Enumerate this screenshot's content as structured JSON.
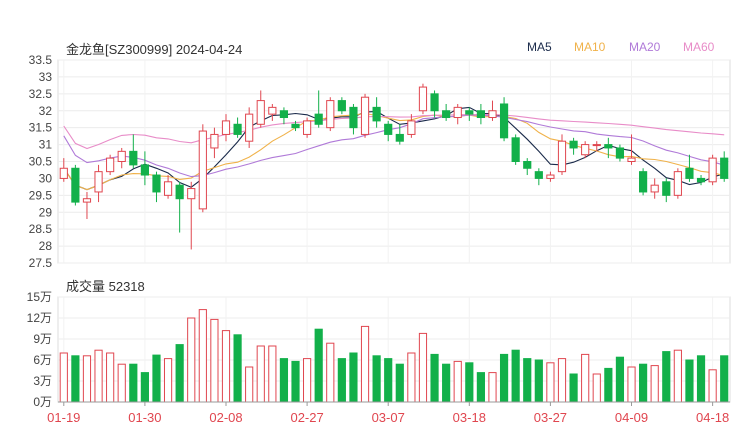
{
  "title": "金龙鱼[SZ300999] 2024-04-24",
  "volume_label": "成交量 52318",
  "legend": [
    {
      "name": "MA5",
      "color": "#1a2a4a"
    },
    {
      "name": "MA10",
      "color": "#f0b24a"
    },
    {
      "name": "MA20",
      "color": "#b07ad8"
    },
    {
      "name": "MA60",
      "color": "#e88cc8"
    }
  ],
  "colors": {
    "up": "#e0464f",
    "down": "#12b04a"
  },
  "chart_data": [
    {
      "type": "candlestick",
      "ylim": [
        27.5,
        33.5
      ],
      "yticks": [
        "33.5",
        "33",
        "32.5",
        "32",
        "31.5",
        "31",
        "30.5",
        "30",
        "29.5",
        "29",
        "28.5",
        "28",
        "27.5"
      ],
      "x_tick_labels": [
        {
          "label": "01-19",
          "index": 0
        },
        {
          "label": "01-30",
          "index": 7
        },
        {
          "label": "02-08",
          "index": 14
        },
        {
          "label": "02-27",
          "index": 21
        },
        {
          "label": "03-07",
          "index": 28
        },
        {
          "label": "03-18",
          "index": 35
        },
        {
          "label": "03-27",
          "index": 42
        },
        {
          "label": "04-09",
          "index": 49
        },
        {
          "label": "04-18",
          "index": 56
        }
      ],
      "candles": [
        [
          30.0,
          30.3,
          30.6,
          29.9
        ],
        [
          30.3,
          29.3,
          30.4,
          29.2
        ],
        [
          29.3,
          29.4,
          29.6,
          28.8
        ],
        [
          29.6,
          30.2,
          30.4,
          29.3
        ],
        [
          30.2,
          30.6,
          30.7,
          30.1
        ],
        [
          30.5,
          30.8,
          30.9,
          30.3
        ],
        [
          30.8,
          30.4,
          31.3,
          30.3
        ],
        [
          30.4,
          30.1,
          30.8,
          29.8
        ],
        [
          30.1,
          29.6,
          30.2,
          29.3
        ],
        [
          29.5,
          29.9,
          30.1,
          29.4
        ],
        [
          29.8,
          29.4,
          29.9,
          28.4
        ],
        [
          29.4,
          29.7,
          29.9,
          27.9
        ],
        [
          29.1,
          31.4,
          31.6,
          29.0
        ],
        [
          30.9,
          31.3,
          31.5,
          30.6
        ],
        [
          31.3,
          31.7,
          31.9,
          31.1
        ],
        [
          31.6,
          31.3,
          31.8,
          31.2
        ],
        [
          31.1,
          31.9,
          32.1,
          30.9
        ],
        [
          31.6,
          32.3,
          32.6,
          31.5
        ],
        [
          31.9,
          32.1,
          32.2,
          31.7
        ],
        [
          32.0,
          31.8,
          32.1,
          31.6
        ],
        [
          31.6,
          31.5,
          31.7,
          31.4
        ],
        [
          31.3,
          31.7,
          31.8,
          31.2
        ],
        [
          31.9,
          31.6,
          32.6,
          31.5
        ],
        [
          31.5,
          32.3,
          32.4,
          31.4
        ],
        [
          32.3,
          32.0,
          32.4,
          31.9
        ],
        [
          32.1,
          31.5,
          32.2,
          31.3
        ],
        [
          31.3,
          32.4,
          32.5,
          31.2
        ],
        [
          32.1,
          31.7,
          32.4,
          31.5
        ],
        [
          31.6,
          31.3,
          31.7,
          31.1
        ],
        [
          31.3,
          31.1,
          31.6,
          31.0
        ],
        [
          31.3,
          31.7,
          31.9,
          31.2
        ],
        [
          32.0,
          32.7,
          32.8,
          31.9
        ],
        [
          32.5,
          32.0,
          32.6,
          31.8
        ],
        [
          32.0,
          31.8,
          32.2,
          31.7
        ],
        [
          31.8,
          32.1,
          32.2,
          31.6
        ],
        [
          32.0,
          31.9,
          32.1,
          31.7
        ],
        [
          32.0,
          31.8,
          32.2,
          31.6
        ],
        [
          31.8,
          32.0,
          32.3,
          31.7
        ],
        [
          32.2,
          31.2,
          32.4,
          31.1
        ],
        [
          31.2,
          30.5,
          31.3,
          30.4
        ],
        [
          30.5,
          30.3,
          30.6,
          30.1
        ],
        [
          30.2,
          30.0,
          30.3,
          29.8
        ],
        [
          30.0,
          30.1,
          30.2,
          29.9
        ],
        [
          30.2,
          31.1,
          31.3,
          30.1
        ],
        [
          31.1,
          30.9,
          31.2,
          30.7
        ],
        [
          30.7,
          31.0,
          31.1,
          30.6
        ],
        [
          31.0,
          31.0,
          31.1,
          30.8
        ],
        [
          31.0,
          30.9,
          31.2,
          30.6
        ],
        [
          30.9,
          30.6,
          31.0,
          30.5
        ],
        [
          30.5,
          30.6,
          31.3,
          30.4
        ],
        [
          30.2,
          29.6,
          30.3,
          29.5
        ],
        [
          29.6,
          29.8,
          30.0,
          29.4
        ],
        [
          29.9,
          29.5,
          30.0,
          29.3
        ],
        [
          29.5,
          30.2,
          30.3,
          29.4
        ],
        [
          30.3,
          30.0,
          30.7,
          29.9
        ],
        [
          30.0,
          29.9,
          30.1,
          29.8
        ],
        [
          29.9,
          30.6,
          30.7,
          29.8
        ],
        [
          30.6,
          30.0,
          30.8,
          29.9
        ]
      ]
    },
    {
      "type": "bar",
      "ylim": [
        0,
        150000
      ],
      "yticks": [
        "15万",
        "12万",
        "9万",
        "6万",
        "3万",
        "0万"
      ],
      "volumes": [
        70000,
        66000,
        66000,
        74000,
        70000,
        54000,
        54000,
        42000,
        67000,
        62000,
        82000,
        120000,
        132000,
        118000,
        102000,
        96000,
        50000,
        80000,
        80000,
        62000,
        58000,
        62000,
        104000,
        84000,
        62000,
        70000,
        108000,
        66000,
        62000,
        54000,
        70000,
        98000,
        68000,
        54000,
        58000,
        56000,
        42000,
        42000,
        68000,
        74000,
        62000,
        60000,
        56000,
        62000,
        40000,
        68000,
        40000,
        48000,
        64000,
        50000,
        54000,
        52000,
        72000,
        74000,
        60000,
        66000,
        46000,
        66000
      ]
    }
  ]
}
